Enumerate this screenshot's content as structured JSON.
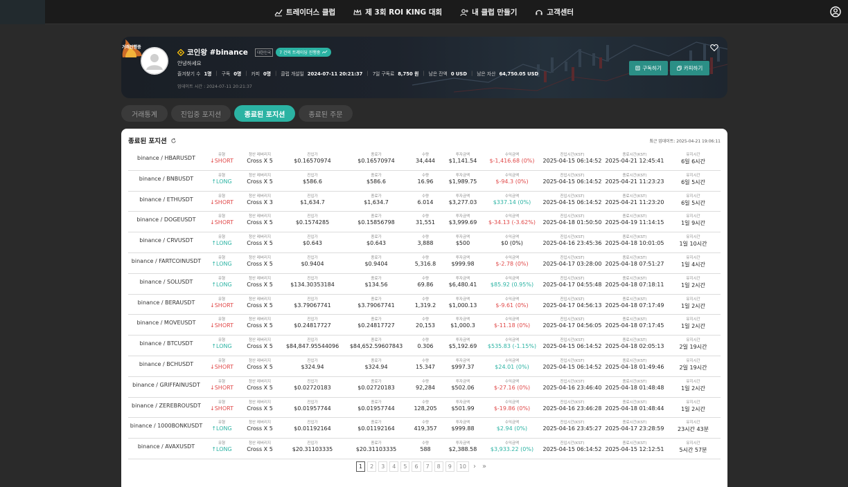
{
  "nav": {
    "items": [
      {
        "label": "트레이더스 클럽",
        "icon": "chart-icon"
      },
      {
        "label": "제 3회 ROI KING 대회",
        "icon": "crown-icon"
      },
      {
        "label": "내 클럽 만들기",
        "icon": "add-user-icon"
      },
      {
        "label": "고객센터",
        "icon": "headset-icon"
      }
    ]
  },
  "profile": {
    "live_badge": "거래진행중",
    "club_name": "코인왕 #binance",
    "country": "대한민국",
    "trading_status": "7 건의 트레이딩 진행중",
    "greeting": "안녕하세요",
    "stats": [
      {
        "label": "즐겨찾기 수",
        "value": "1명"
      },
      {
        "label": "구독",
        "value": "0명"
      },
      {
        "label": "카피",
        "value": "0명"
      },
      {
        "label": "클럽 개설일",
        "value": "2024-07-11 20:21:37"
      },
      {
        "label": "7일 구독료",
        "value": "8,750 원"
      },
      {
        "label": "남은 잔액",
        "value": "0 USD"
      },
      {
        "label": "남은 자산",
        "value": "64,750.05 USD"
      }
    ],
    "updated": "업데이트 시간 : 2024-07-11 20:21:37",
    "subscribe_label": "구독하기",
    "copy_label": "카피하기"
  },
  "tabs": [
    {
      "label": "거래통계",
      "active": false
    },
    {
      "label": "진입중 포지션",
      "active": false
    },
    {
      "label": "종료된 포지션",
      "active": true
    },
    {
      "label": "종료된 주문",
      "active": false
    }
  ],
  "panel": {
    "title": "종료된 포지션",
    "last_updated": "최근 업데이트: 2025-04-21 19:06:11"
  },
  "columns": {
    "type": "유형",
    "leverage": "청산 레버리지",
    "entry": "진입가",
    "exit": "종료가",
    "qty": "수량",
    "invest": "투자금액",
    "pnl": "수익금액",
    "entry_time": "진입시간(KST)",
    "exit_time": "종료시간(KST)",
    "hold": "유지시간"
  },
  "rows": [
    {
      "pair": "binance / HBARUSDT",
      "side": "SHORT",
      "leverage": "Cross X 5",
      "entry": "$0.16570974",
      "exit": "$0.16570974",
      "qty": "34,444",
      "invest": "$1,141.54",
      "pnl": "$-1,416.68 (0%)",
      "pnl_sign": "neg",
      "entry_time": "2025-04-15 06:14:52",
      "exit_time": "2025-04-21 12:45:41",
      "hold": "6일 6시간"
    },
    {
      "pair": "binance / BNBUSDT",
      "side": "LONG",
      "leverage": "Cross X 5",
      "entry": "$586.6",
      "exit": "$586.6",
      "qty": "16.96",
      "invest": "$1,989.75",
      "pnl": "$-94.3 (0%)",
      "pnl_sign": "neg",
      "entry_time": "2025-04-15 06:14:52",
      "exit_time": "2025-04-21 11:23:23",
      "hold": "6일 5시간"
    },
    {
      "pair": "binance / ETHUSDT",
      "side": "SHORT",
      "leverage": "Cross X 3",
      "entry": "$1,634.7",
      "exit": "$1,634.7",
      "qty": "6.014",
      "invest": "$3,277.03",
      "pnl": "$337.14 (0%)",
      "pnl_sign": "pos",
      "entry_time": "2025-04-15 06:14:52",
      "exit_time": "2025-04-21 11:23:20",
      "hold": "6일 5시간"
    },
    {
      "pair": "binance / DOGEUSDT",
      "side": "SHORT",
      "leverage": "Cross X 5",
      "entry": "$0.1574285",
      "exit": "$0.15856798",
      "qty": "31,551",
      "invest": "$3,999.69",
      "pnl": "$-34.13 (-3.62%)",
      "pnl_sign": "neg",
      "entry_time": "2025-04-18 01:50:50",
      "exit_time": "2025-04-19 11:14:15",
      "hold": "1일 9시간"
    },
    {
      "pair": "binance / CRVUSDT",
      "side": "LONG",
      "leverage": "Cross X 5",
      "entry": "$0.643",
      "exit": "$0.643",
      "qty": "3,888",
      "invest": "$500",
      "pnl": "$0 (0%)",
      "pnl_sign": "zero",
      "entry_time": "2025-04-16 23:45:36",
      "exit_time": "2025-04-18 10:01:05",
      "hold": "1일 10시간"
    },
    {
      "pair": "binance / FARTCOINUSDT",
      "side": "LONG",
      "leverage": "Cross X 5",
      "entry": "$0.9404",
      "exit": "$0.9404",
      "qty": "5,316.8",
      "invest": "$999.98",
      "pnl": "$-2.78 (0%)",
      "pnl_sign": "neg",
      "entry_time": "2025-04-17 03:28:00",
      "exit_time": "2025-04-18 07:51:27",
      "hold": "1일 4시간"
    },
    {
      "pair": "binance / SOLUSDT",
      "side": "LONG",
      "leverage": "Cross X 5",
      "entry": "$134.30353184",
      "exit": "$134.56",
      "qty": "69.86",
      "invest": "$6,480.41",
      "pnl": "$85.92 (0.95%)",
      "pnl_sign": "pos",
      "entry_time": "2025-04-17 04:55:48",
      "exit_time": "2025-04-18 07:18:11",
      "hold": "1일 2시간"
    },
    {
      "pair": "binance / BERAUSDT",
      "side": "SHORT",
      "leverage": "Cross X 5",
      "entry": "$3.79067741",
      "exit": "$3.79067741",
      "qty": "1,319.2",
      "invest": "$1,000.13",
      "pnl": "$-9.61 (0%)",
      "pnl_sign": "neg",
      "entry_time": "2025-04-17 04:56:13",
      "exit_time": "2025-04-18 07:17:49",
      "hold": "1일 2시간"
    },
    {
      "pair": "binance / MOVEUSDT",
      "side": "SHORT",
      "leverage": "Cross X 5",
      "entry": "$0.24817727",
      "exit": "$0.24817727",
      "qty": "20,153",
      "invest": "$1,000.3",
      "pnl": "$-11.18 (0%)",
      "pnl_sign": "neg",
      "entry_time": "2025-04-17 04:56:05",
      "exit_time": "2025-04-18 07:17:45",
      "hold": "1일 2시간"
    },
    {
      "pair": "binance / BTCUSDT",
      "side": "LONG",
      "leverage": "Cross X 5",
      "entry": "$84,847.95544096",
      "exit": "$84,652.59607843",
      "qty": "0.306",
      "invest": "$5,192.69",
      "pnl": "$535.83 (-1.15%)",
      "pnl_sign": "pos",
      "entry_time": "2025-04-15 06:14:52",
      "exit_time": "2025-04-18 02:05:13",
      "hold": "2일 19시간"
    },
    {
      "pair": "binance / BCHUSDT",
      "side": "SHORT",
      "leverage": "Cross X 5",
      "entry": "$324.94",
      "exit": "$324.94",
      "qty": "15.347",
      "invest": "$997.37",
      "pnl": "$24.01 (0%)",
      "pnl_sign": "pos",
      "entry_time": "2025-04-15 06:14:52",
      "exit_time": "2025-04-18 01:49:46",
      "hold": "2일 19시간"
    },
    {
      "pair": "binance / GRIFFAINUSDT",
      "side": "SHORT",
      "leverage": "Cross X 5",
      "entry": "$0.02720183",
      "exit": "$0.02720183",
      "qty": "92,284",
      "invest": "$502.06",
      "pnl": "$-27.16 (0%)",
      "pnl_sign": "neg",
      "entry_time": "2025-04-16 23:46:40",
      "exit_time": "2025-04-18 01:48:48",
      "hold": "1일 2시간"
    },
    {
      "pair": "binance / ZEREBROUSDT",
      "side": "SHORT",
      "leverage": "Cross X 5",
      "entry": "$0.01957744",
      "exit": "$0.01957744",
      "qty": "128,205",
      "invest": "$501.99",
      "pnl": "$-19.86 (0%)",
      "pnl_sign": "neg",
      "entry_time": "2025-04-16 23:46:28",
      "exit_time": "2025-04-18 01:48:44",
      "hold": "1일 2시간"
    },
    {
      "pair": "binance / 1000BONKUSDT",
      "side": "LONG",
      "leverage": "Cross X 5",
      "entry": "$0.01192164",
      "exit": "$0.01192164",
      "qty": "419,357",
      "invest": "$999.88",
      "pnl": "$2.94 (0%)",
      "pnl_sign": "pos",
      "entry_time": "2025-04-16 23:45:27",
      "exit_time": "2025-04-17 23:28:59",
      "hold": "23시간 43분"
    },
    {
      "pair": "binance / AVAXUSDT",
      "side": "LONG",
      "leverage": "Cross X 5",
      "entry": "$20.31103335",
      "exit": "$20.31103335",
      "qty": "588",
      "invest": "$2,388.58",
      "pnl": "$3,933.22 (0%)",
      "pnl_sign": "pos",
      "entry_time": "2025-04-15 06:14:52",
      "exit_time": "2025-04-15 12:12:51",
      "hold": "5시간 57분"
    }
  ],
  "pagination": {
    "pages": [
      "1",
      "2",
      "3",
      "4",
      "5",
      "6",
      "7",
      "8",
      "9",
      "10"
    ],
    "current": "1",
    "next": "›",
    "last": "»"
  },
  "colors": {
    "accent": "#2bb3a3",
    "negative": "#e04848",
    "nav_bg": "#1b1b1b",
    "page_bg": "#2a2a2a"
  }
}
